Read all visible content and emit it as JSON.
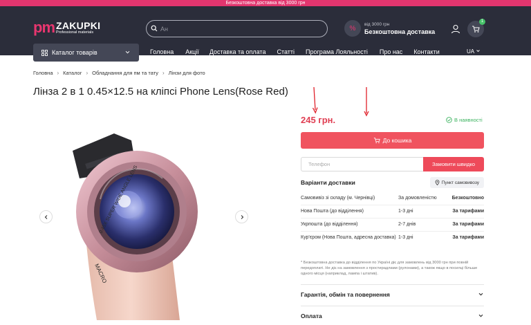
{
  "promo": {
    "text": "Безкоштовна доставка від 3000 грн"
  },
  "header": {
    "logo_pm": "pm",
    "logo_name": "ZAKUPKI",
    "logo_sub": "Professional materials",
    "search_value": "",
    "search_placeholder": "Ан",
    "shipping_small": "від 3000 грн",
    "shipping_big": "Безкоштовна доставка",
    "cart_count": "1"
  },
  "nav": {
    "catalog_label": "Каталог товарів",
    "items": [
      "Головна",
      "Акції",
      "Доставка та оплата",
      "Статті",
      "Програма Лояльності",
      "Про нас",
      "Контакти"
    ],
    "lang": "UA"
  },
  "breadcrumb": [
    "Головна",
    "Каталог",
    "Обладнання для пм та тату",
    "Лінзи для фото"
  ],
  "product": {
    "title": "Лінза 2 в 1 0.45×12.5 на кліпсі Phone Lens(Rose Red)",
    "price": "245 грн.",
    "stock": "В наявності",
    "add_to_cart": "До кошика",
    "phone_placeholder": "Телефон",
    "quick_order": "Замовити швидко",
    "image_text": {
      "ring": "0.45X SUPER WIDE ANGLE LENS",
      "macro": "MACRO"
    }
  },
  "delivery": {
    "title": "Варіанти доставки",
    "pickup_btn": "Пункт самовивозу",
    "rows": [
      {
        "method": "Самовивіз зі складу (м. Чернівці)",
        "time": "За домовленістю",
        "price": "Безкоштовно"
      },
      {
        "method": "Нова Пошта (до відділення)",
        "time": "1-3 дні",
        "price": "За тарифами"
      },
      {
        "method": "Укрпошта (до відділення)",
        "time": "2-7 днів",
        "price": "За тарифами"
      },
      {
        "method": "Кур'єром (Нова Пошта, адресна доставка)",
        "time": "1-3 дні",
        "price": "За тарифами"
      }
    ],
    "note": "* Безкоштовна доставка до відділення по Україні діє для замовлень від 3000 грн при повній передоплаті. Не діє на замовлення з простирадлами (рулонами), а також якщо в посилці більше одного місця (наприклад, лампа і штатив)."
  },
  "accordions": [
    "Гарантія, обмін та повернення",
    "Оплата"
  ],
  "colors": {
    "accent": "#e8366f",
    "header_bg": "#2b2d3a",
    "price": "#e03e52",
    "button": "#f0535f",
    "stock": "#3bb35f"
  }
}
